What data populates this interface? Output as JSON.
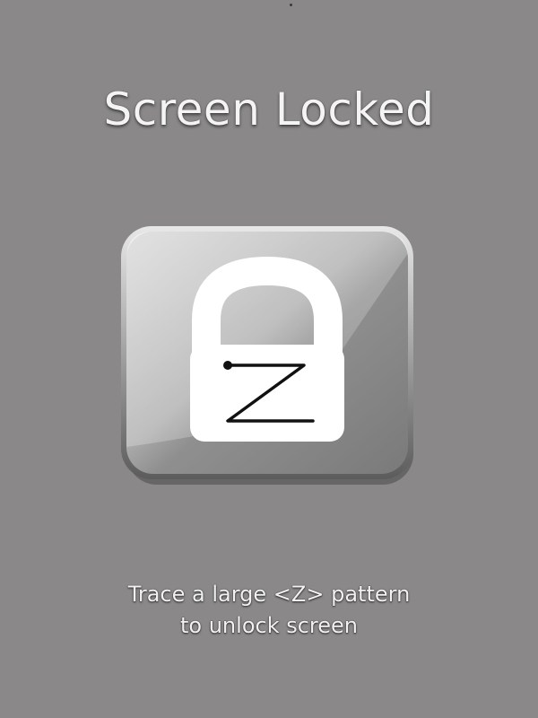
{
  "lock_screen": {
    "title": "Screen Locked",
    "instruction_line1": "Trace a large <Z> pattern",
    "instruction_line2": "to unlock screen",
    "icon": "padlock-z-icon"
  },
  "colors": {
    "background": "#8a8889",
    "title_text": "#f4f4f4",
    "lock_body": "#ffffff",
    "z_stroke": "#111111"
  }
}
